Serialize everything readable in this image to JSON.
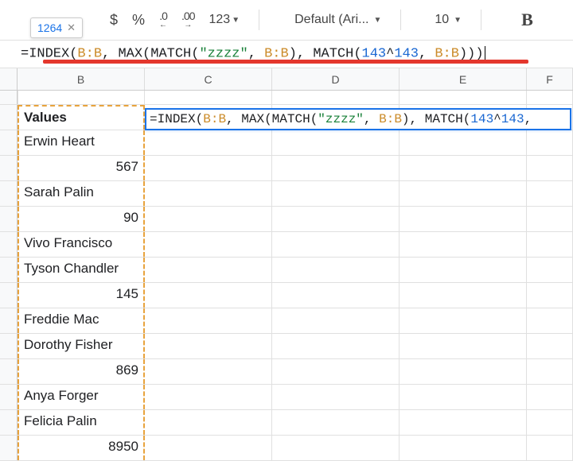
{
  "toolbar": {
    "result_value": "1264",
    "currency_label": "$",
    "percent_label": "%",
    "dec_dec_label": ".0",
    "dec_inc_label": ".00",
    "numfmt_label": "123",
    "font_label": "Default (Ari...",
    "fontsize_label": "10",
    "bold_label": "B"
  },
  "formula_bar": {
    "prefix": "=",
    "fn_index": "INDEX",
    "ref1": "B:B",
    "fn_max": "MAX",
    "fn_match1": "MATCH",
    "str1": "\"zzzz\"",
    "ref2": "B:B",
    "fn_match2": "MATCH",
    "num1": "143",
    "op": "^",
    "num2": "143",
    "ref3": "B:B"
  },
  "columns": {
    "B": "B",
    "C": "C",
    "D": "D",
    "E": "E",
    "F": "F"
  },
  "active_cell": {
    "prefix": "=",
    "fn_index": "INDEX",
    "ref1": "B:B",
    "fn_max": "MAX",
    "fn_match1": "MATCH",
    "str1": "\"zzzz\"",
    "ref2": "B:B",
    "fn_match2": "MATCH",
    "num1": "143",
    "op": "^",
    "num2": "143",
    "tail": ","
  },
  "cells": {
    "header": "Values",
    "rows": [
      "Erwin Heart",
      "567",
      "Sarah Palin",
      "90",
      "Vivo Francisco",
      "Tyson Chandler",
      "145",
      "Freddie Mac",
      "Dorothy Fisher",
      "869",
      "Anya Forger",
      "Felicia Palin",
      "8950"
    ],
    "numeric_flags": [
      false,
      true,
      false,
      true,
      false,
      false,
      true,
      false,
      false,
      true,
      false,
      false,
      true
    ]
  }
}
